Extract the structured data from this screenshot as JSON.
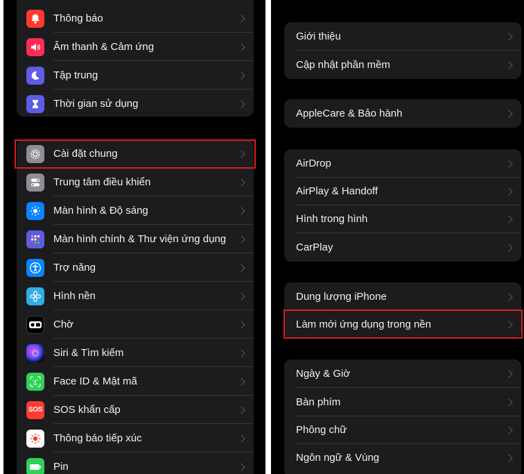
{
  "left_panel": {
    "group1": [
      {
        "label": "Thông báo",
        "icon": "bell-icon",
        "color": "#ff3b30"
      },
      {
        "label": "Âm thanh & Cảm ứng",
        "icon": "speaker-icon",
        "color": "#ff2d55"
      },
      {
        "label": "Tập trung",
        "icon": "moon-icon",
        "color": "#5e5ce6"
      },
      {
        "label": "Thời gian sử dụng",
        "icon": "hourglass-icon",
        "color": "#5e5ce6"
      }
    ],
    "group2": [
      {
        "label": "Cài đặt chung",
        "icon": "gear-icon",
        "color": "#8e8e93",
        "highlighted": true
      },
      {
        "label": "Trung tâm điều khiển",
        "icon": "toggles-icon",
        "color": "#8e8e93"
      },
      {
        "label": "Màn hình & Độ sáng",
        "icon": "sun-icon",
        "color": "#0a84ff"
      },
      {
        "label": "Màn hình chính & Thư viện ứng dụng",
        "icon": "home-grid-icon",
        "color": "#5e5ce6"
      },
      {
        "label": "Trợ năng",
        "icon": "accessibility-icon",
        "color": "#0a84ff"
      },
      {
        "label": "Hình nền",
        "icon": "flower-icon",
        "color": "#32ade6"
      },
      {
        "label": "Chờ",
        "icon": "standby-icon",
        "color": "#1c1c1e"
      },
      {
        "label": "Siri & Tìm kiếm",
        "icon": "siri-icon",
        "color": "#2c2c6e"
      },
      {
        "label": "Face ID & Mật mã",
        "icon": "faceid-icon",
        "color": "#30d158"
      },
      {
        "label": "SOS khẩn cấp",
        "icon": "sos-icon",
        "color": "#ff3b30",
        "icon_text": "SOS"
      },
      {
        "label": "Thông báo tiếp xúc",
        "icon": "exposure-icon",
        "color": "#ffffff"
      },
      {
        "label": "Pin",
        "icon": "battery-icon",
        "color": "#30d158"
      }
    ]
  },
  "right_panel": {
    "group1": [
      {
        "label": "Giới thiệu"
      },
      {
        "label": "Cập nhật phần mềm"
      }
    ],
    "group2": [
      {
        "label": "AppleCare & Bảo hành"
      }
    ],
    "group3": [
      {
        "label": "AirDrop"
      },
      {
        "label": "AirPlay & Handoff"
      },
      {
        "label": "Hình trong hình"
      },
      {
        "label": "CarPlay"
      }
    ],
    "group4": [
      {
        "label": "Dung lượng iPhone"
      },
      {
        "label": "Làm mới ứng dụng trong nền",
        "highlighted": true
      }
    ],
    "group5": [
      {
        "label": "Ngày & Giờ"
      },
      {
        "label": "Bàn phím"
      },
      {
        "label": "Phông chữ"
      },
      {
        "label": "Ngôn ngữ & Vùng"
      }
    ]
  },
  "colors": {
    "highlight_border": "#d91e1e",
    "row_background": "#1c1c1e"
  }
}
